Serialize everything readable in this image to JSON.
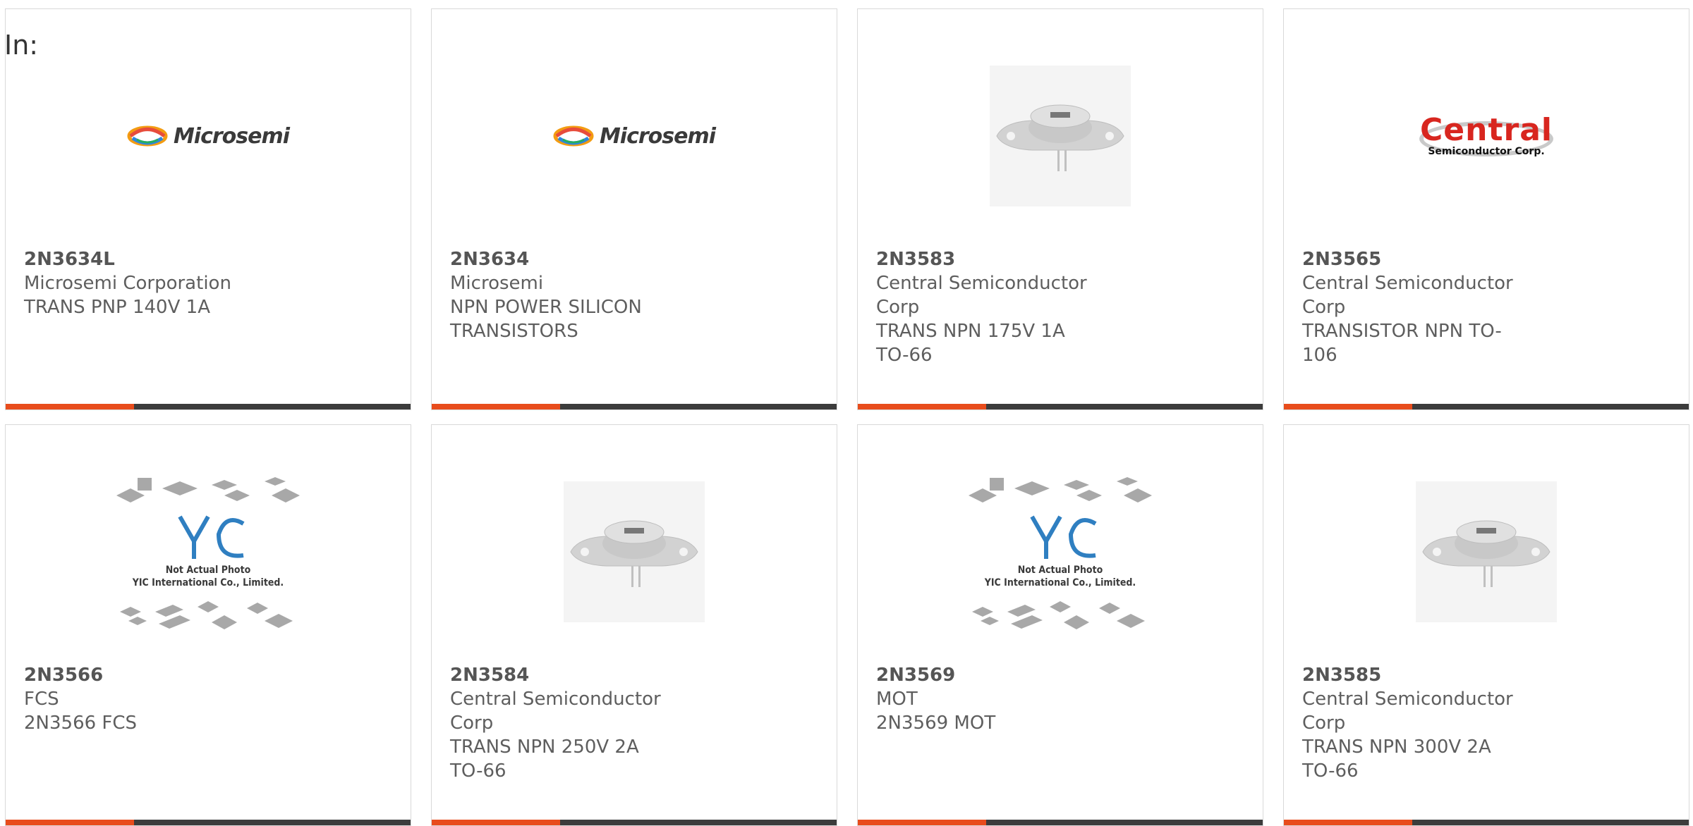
{
  "header": {
    "prefix": "In:"
  },
  "products": [
    {
      "part_number": "2N3634L",
      "manufacturer": "Microsemi Corporation",
      "description": "TRANS PNP 140V 1A",
      "image": "microsemi-logo"
    },
    {
      "part_number": "2N3634",
      "manufacturer": "Microsemi",
      "description": "NPN POWER SILICON TRANSISTORS",
      "image": "microsemi-logo"
    },
    {
      "part_number": "2N3583",
      "manufacturer": "Central Semiconductor Corp",
      "description": "TRANS NPN 175V 1A TO-66",
      "image": "to66-transistor"
    },
    {
      "part_number": "2N3565",
      "manufacturer": "Central Semiconductor Corp",
      "description": "TRANSISTOR NPN TO-106",
      "image": "central-logo"
    },
    {
      "part_number": "2N3566",
      "manufacturer": "FCS",
      "description": "2N3566 FCS",
      "image": "yic-placeholder"
    },
    {
      "part_number": "2N3584",
      "manufacturer": "Central Semiconductor Corp",
      "description": "TRANS NPN 250V 2A TO-66",
      "image": "to66-transistor"
    },
    {
      "part_number": "2N3569",
      "manufacturer": "MOT",
      "description": "2N3569 MOT",
      "image": "yic-placeholder"
    },
    {
      "part_number": "2N3585",
      "manufacturer": "Central Semiconductor Corp",
      "description": "TRANS NPN 300V 2A TO-66",
      "image": "to66-transistor"
    }
  ],
  "logos": {
    "microsemi": "Microsemi",
    "central_main": "Central",
    "central_sub": "Semiconductor Corp.",
    "yic_line1": "Not Actual Photo",
    "yic_line2": "YIC International Co., Limited."
  },
  "colors": {
    "accent": "#e84c1c",
    "bar": "#3c3c3c",
    "border": "#d9d9d9"
  }
}
